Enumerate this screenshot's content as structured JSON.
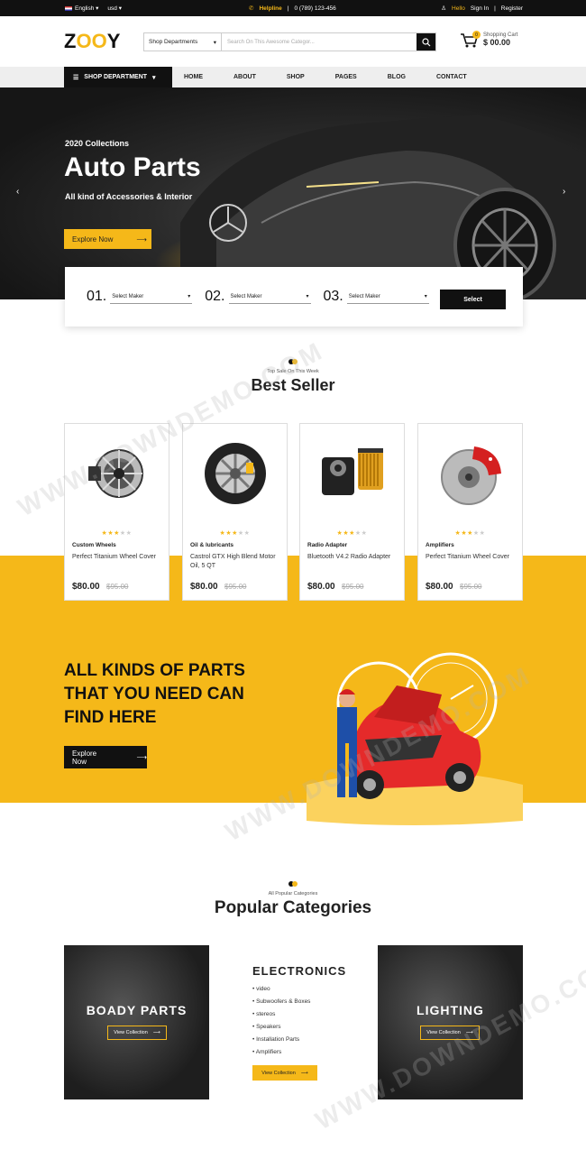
{
  "topbar": {
    "language": "English",
    "currency": "usd",
    "helpline_label": "Helpline",
    "phone": "0 (789) 123-456",
    "hello": "Hello",
    "signin": "Sign In",
    "register": "Register"
  },
  "header": {
    "logo_a": "Z",
    "logo_oo": "OO",
    "logo_b": "Y",
    "dept_select": "Shop Departments",
    "search_placeholder": "Search On This Awesome Categor...",
    "cart_label": "Shopping Cart",
    "cart_total": "$ 00.00",
    "cart_count": "0"
  },
  "nav": {
    "department": "SHOP DEPARTMENT",
    "items": [
      "HOME",
      "ABOUT",
      "SHOP",
      "PAGES",
      "BLOG",
      "CONTACT"
    ]
  },
  "hero": {
    "subtitle": "2020 Collections",
    "title": "Auto Parts",
    "description": "All kind of Accessories & Interior",
    "button": "Explore Now"
  },
  "finder": {
    "steps": [
      {
        "num": "01.",
        "label": "Select Maker"
      },
      {
        "num": "02.",
        "label": "Select Maker"
      },
      {
        "num": "03.",
        "label": "Select Maker"
      }
    ],
    "button": "Select"
  },
  "bestseller": {
    "eyebrow": "Top Sale On This Week",
    "title": "Best Seller"
  },
  "products": [
    {
      "category": "Custom Wheels",
      "name": "Perfect Titanium Wheel Cover",
      "price": "$80.00",
      "old_price": "$95.00",
      "rating": 3,
      "icon": "alternator-icon"
    },
    {
      "category": "Oil & lubricants",
      "name": "Castrol GTX High Blend Motor Oil, 5 QT",
      "price": "$80.00",
      "old_price": "$95.00",
      "rating": 3,
      "icon": "tire-icon"
    },
    {
      "category": "Radio Adapter",
      "name": "Bluetooth V4.2 Radio Adapter",
      "price": "$80.00",
      "old_price": "$95.00",
      "rating": 3,
      "icon": "oil-filter-icon"
    },
    {
      "category": "Amplifiers",
      "name": "Perfect Titanium Wheel Cover",
      "price": "$80.00",
      "old_price": "$95.00",
      "rating": 3,
      "icon": "brake-disc-icon"
    }
  ],
  "promo": {
    "line1": "ALL KINDS OF PARTS",
    "line2": "THAT YOU NEED CAN",
    "line3": "FIND HERE",
    "button": "Explore Now"
  },
  "categories": {
    "eyebrow": "All Popular Categories",
    "title": "Popular Categories",
    "left": {
      "title": "BOADY PARTS",
      "button": "View Collection"
    },
    "middle": {
      "title": "ELECTRONICS",
      "items": [
        "video",
        "Subwoofers & Boxes",
        "stereos",
        "Speakers",
        "Installation Parts",
        "Amplifiers"
      ],
      "button": "View Collection"
    },
    "right": {
      "title": "LIGHTING",
      "button": "View Collection"
    }
  },
  "watermark": "WWW.DOWNDEMO.COM",
  "colors": {
    "accent": "#f5b819",
    "dark": "#111111"
  }
}
